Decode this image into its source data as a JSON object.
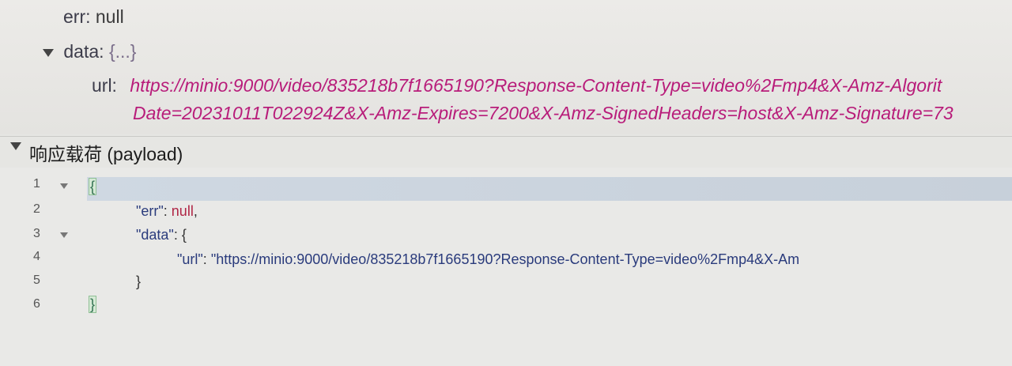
{
  "tree": {
    "err_key": "err:",
    "err_value": "null",
    "data_key": "data:",
    "data_collapsed": "{...}",
    "url_key": "url:",
    "url_line1": "https://minio:9000/video/835218b7f1665190?Response-Content-Type=video%2Fmp4&X-Amz-Algorit",
    "url_line2": "Date=20231011T022924Z&X-Amz-Expires=7200&X-Amz-SignedHeaders=host&X-Amz-Signature=73"
  },
  "payload": {
    "title": "响应载荷 (payload)"
  },
  "editor": {
    "line_numbers": [
      "1",
      "2",
      "3",
      "4",
      "5",
      "6"
    ],
    "line1_brace": "{",
    "line2_key": "\"err\"",
    "line2_colon": ": ",
    "line2_value": "null",
    "line2_comma": ",",
    "line3_key": "\"data\"",
    "line3_rest": ": {",
    "line4_key": "\"url\"",
    "line4_colon": ": ",
    "line4_value": "\"https://minio:9000/video/835218b7f1665190?Response-Content-Type=video%2Fmp4&X-Am",
    "line5_brace": "}",
    "line6_brace": "}"
  }
}
